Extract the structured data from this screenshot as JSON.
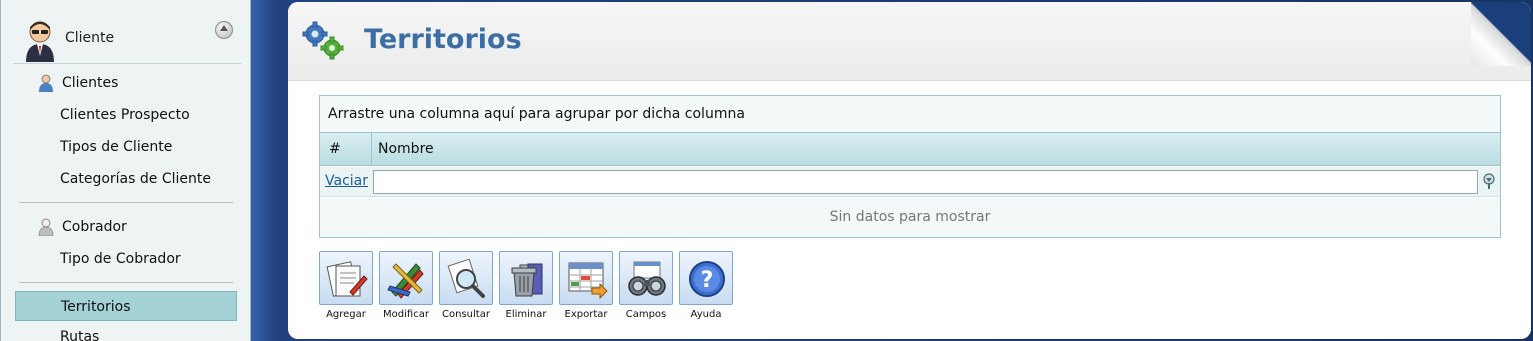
{
  "sidebar": {
    "header_title": "Cliente",
    "groups": [
      {
        "label": "Clientes",
        "icon": "user-icon"
      },
      {
        "label": "Cobrador",
        "icon": "collector-icon"
      }
    ],
    "items": [
      {
        "label": "Clientes Prospecto"
      },
      {
        "label": "Tipos de Cliente"
      },
      {
        "label": "Categorías de Cliente"
      },
      {
        "label": "Tipo de Cobrador"
      },
      {
        "label": "Territorios",
        "active": true
      },
      {
        "label": "Rutas"
      }
    ]
  },
  "page": {
    "title": "Territorios",
    "icon": "gears-icon"
  },
  "grid": {
    "group_hint": "Arrastre una columna aquí para agrupar por dicha columna",
    "columns": [
      "#",
      "Nombre"
    ],
    "filter_clear_label": "Vaciar",
    "filter_value": "",
    "empty_message": "Sin datos para mostrar"
  },
  "toolbar": {
    "buttons": [
      {
        "label": "Agregar",
        "icon": "add-document-icon"
      },
      {
        "label": "Modificar",
        "icon": "edit-pencils-icon"
      },
      {
        "label": "Consultar",
        "icon": "search-document-icon"
      },
      {
        "label": "Eliminar",
        "icon": "trash-icon"
      },
      {
        "label": "Exportar",
        "icon": "export-spreadsheet-icon"
      },
      {
        "label": "Campos",
        "icon": "binoculars-icon"
      },
      {
        "label": "Ayuda",
        "icon": "help-icon"
      }
    ]
  },
  "colors": {
    "title": "#3a6ea5",
    "active_item": "#a4d2d6",
    "grid_border": "#9fc4cb",
    "background": "#1b3f7a"
  }
}
